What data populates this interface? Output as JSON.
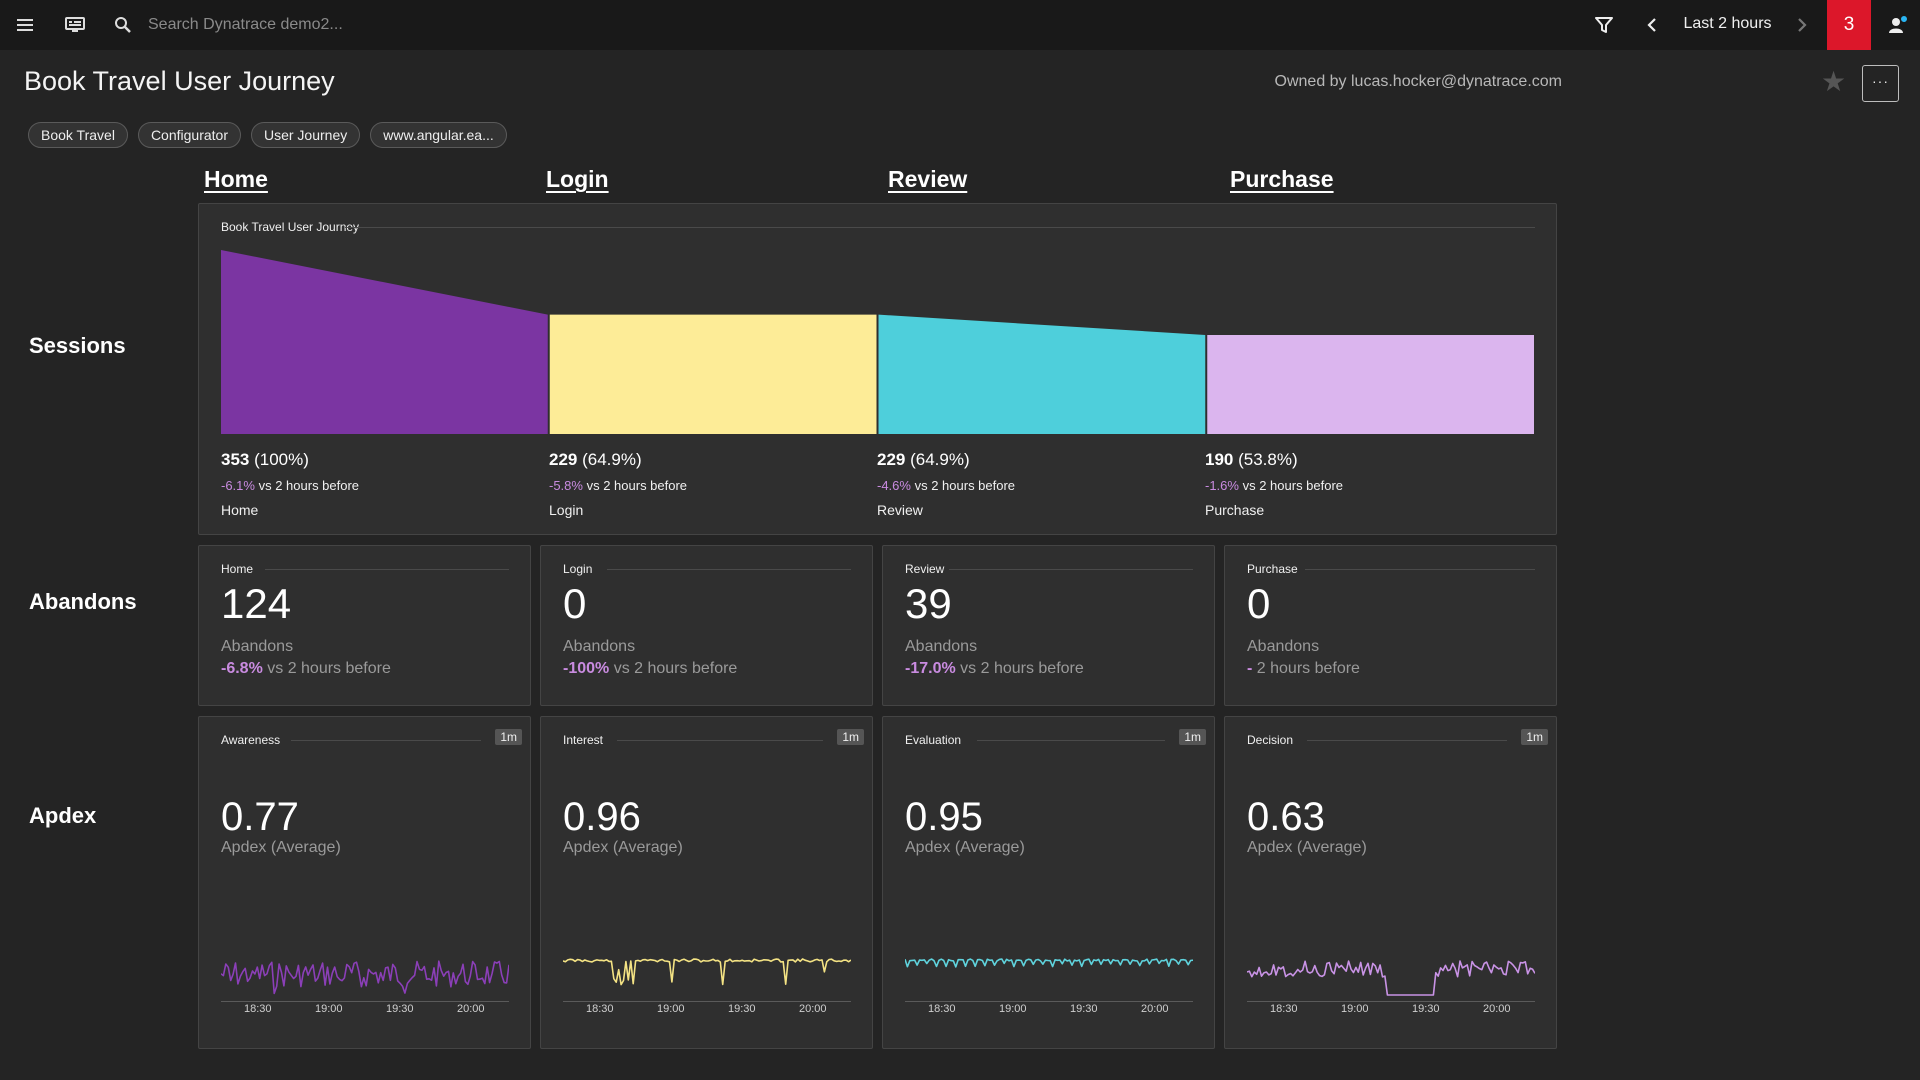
{
  "topbar": {
    "search_placeholder": "Search Dynatrace demo2...",
    "timeframe": "Last 2 hours",
    "problem_count": "3"
  },
  "header": {
    "title": "Book Travel User Journey",
    "owner": "Owned by lucas.hocker@dynatrace.com",
    "more_label": "···"
  },
  "tags": [
    "Book Travel",
    "Configurator",
    "User Journey",
    "www.angular.ea..."
  ],
  "steps": [
    "Home",
    "Login",
    "Review",
    "Purchase"
  ],
  "row_labels": {
    "sessions": "Sessions",
    "abandons": "Abandons",
    "apdex": "Apdex"
  },
  "funnel": {
    "title": "Book Travel User Journey",
    "comparison_suffix": "vs 2 hours before",
    "stages": [
      {
        "name": "Home",
        "count": "353",
        "percent": "(100%)",
        "delta": "-6.1%",
        "color": "#7b35a2",
        "value": 353
      },
      {
        "name": "Login",
        "count": "229",
        "percent": "(64.9%)",
        "delta": "-5.8%",
        "color": "#fdec97",
        "value": 229
      },
      {
        "name": "Review",
        "count": "229",
        "percent": "(64.9%)",
        "delta": "-4.6%",
        "color": "#4ecfdb",
        "value": 229
      },
      {
        "name": "Purchase",
        "count": "190",
        "percent": "(53.8%)",
        "delta": "-1.6%",
        "color": "#dbb5ee",
        "value": 190
      }
    ]
  },
  "abandons": {
    "caption": "Abandons",
    "tiles": [
      {
        "title": "Home",
        "value": "124",
        "delta": "-6.8%",
        "suffix": " vs 2 hours before"
      },
      {
        "title": "Login",
        "value": "0",
        "delta": "-100%",
        "suffix": " vs 2 hours before"
      },
      {
        "title": "Review",
        "value": "39",
        "delta": "-17.0%",
        "suffix": " vs 2 hours before"
      },
      {
        "title": "Purchase",
        "value": "0",
        "delta": "-",
        "suffix": " 2 hours before"
      }
    ]
  },
  "apdex": {
    "caption": "Apdex (Average)",
    "badge": "1m",
    "time_labels": [
      "18:30",
      "19:00",
      "19:30",
      "20:00"
    ],
    "tiles": [
      {
        "title": "Awareness",
        "value": "0.77",
        "color": "#8b3fb8"
      },
      {
        "title": "Interest",
        "value": "0.96",
        "color": "#f4e384"
      },
      {
        "title": "Evaluation",
        "value": "0.95",
        "color": "#5fd3dd"
      },
      {
        "title": "Decision",
        "value": "0.63",
        "color": "#c993e6"
      }
    ]
  }
}
